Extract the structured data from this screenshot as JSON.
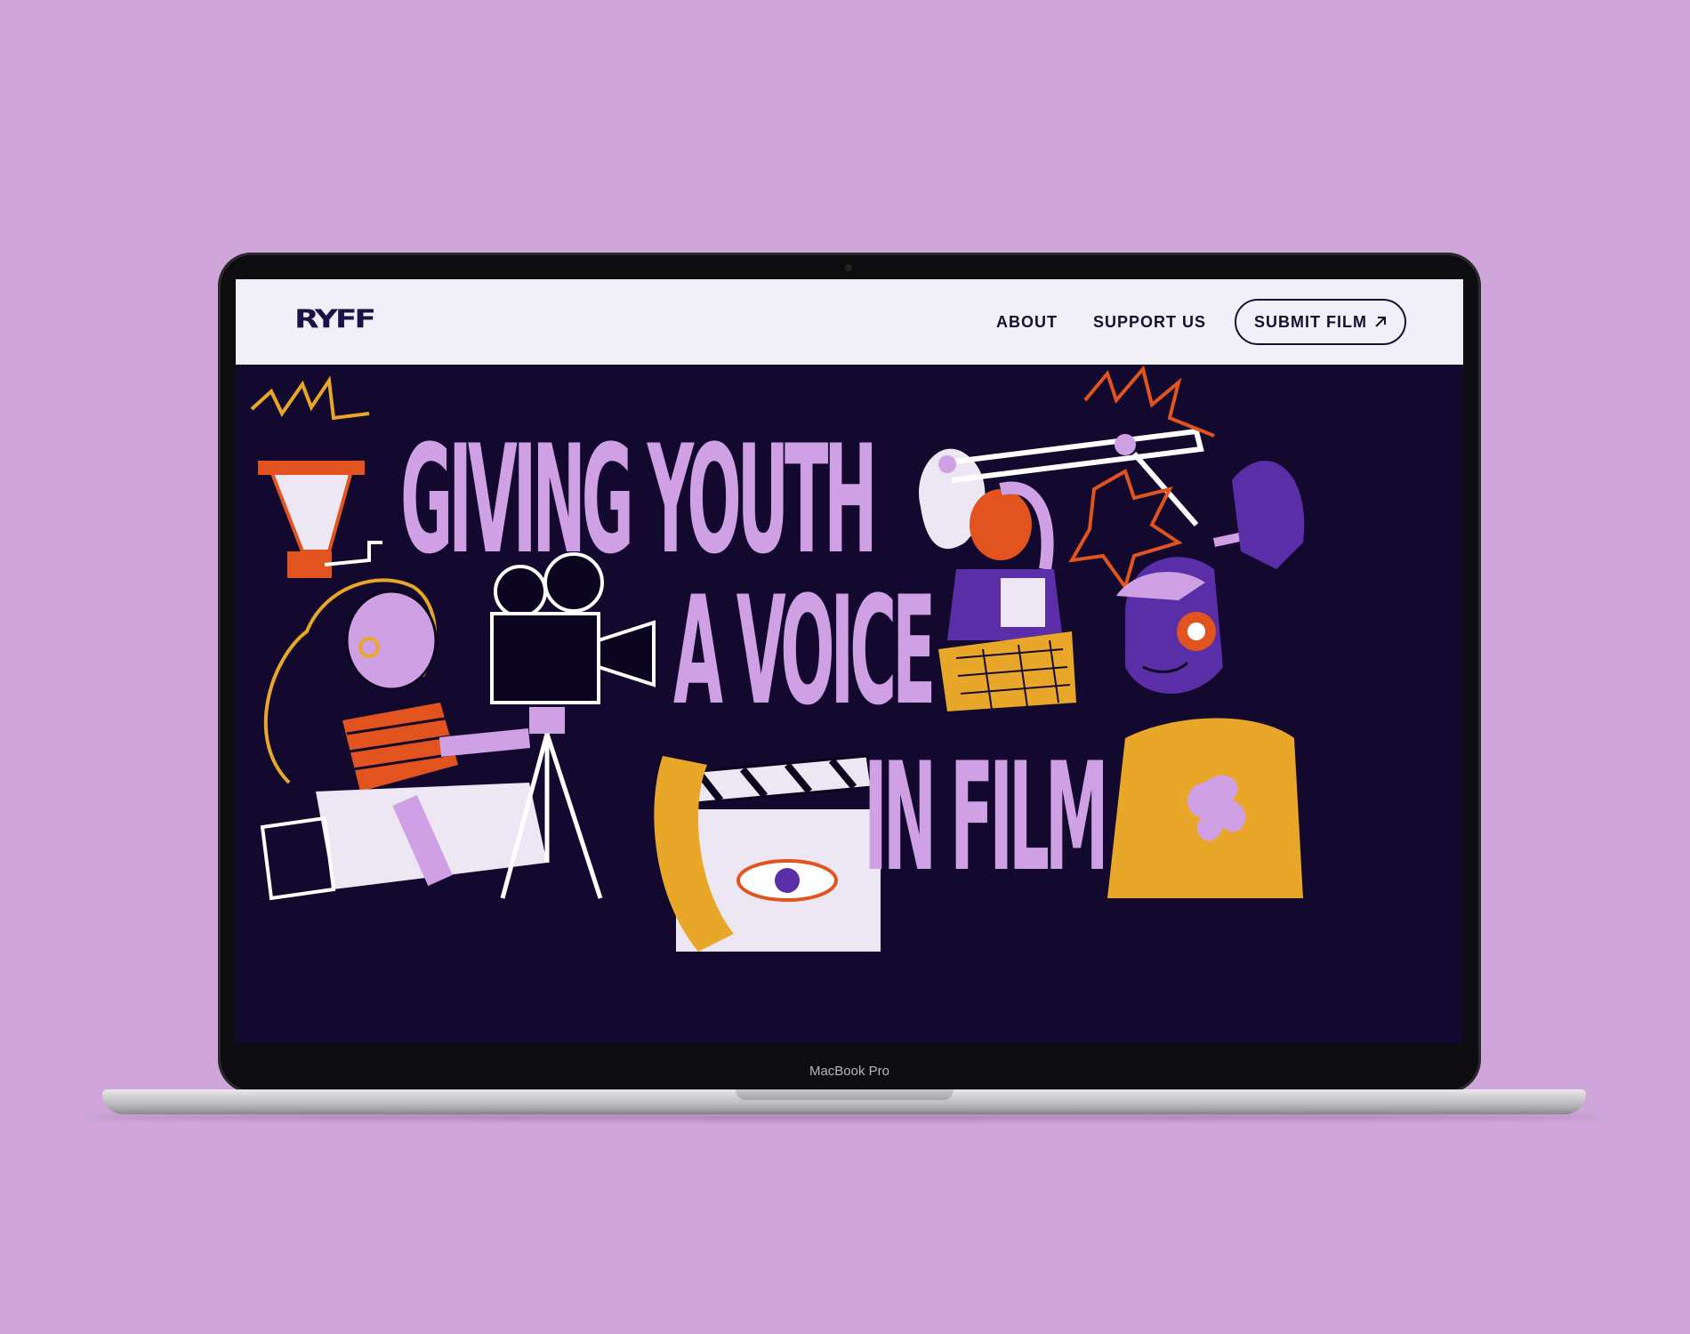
{
  "site": {
    "logo": "RYFF",
    "nav": {
      "about": "ABOUT",
      "support": "SUPPORT US",
      "submit": "SUBMIT FILM",
      "submit_icon": "arrow-up-right-icon"
    }
  },
  "hero": {
    "headline": [
      "GIVING YOUTH",
      "A VOICE",
      "IN FILM"
    ]
  },
  "device": {
    "label": "MacBook Pro"
  },
  "colors": {
    "background": "#d0a6da",
    "hero_bg": "#13082e",
    "headline": "#cfa0e3",
    "orange": "#e2541f",
    "yellow": "#e9a72a",
    "purple": "#5a2ea6"
  }
}
